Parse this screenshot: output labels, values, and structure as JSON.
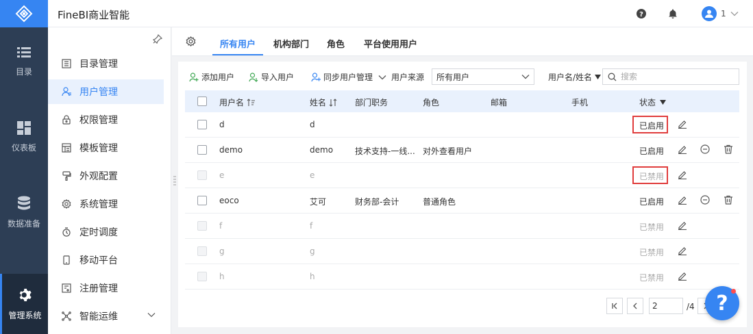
{
  "app": {
    "title": "FineBI商业智能"
  },
  "user": {
    "name": "1"
  },
  "rail": [
    {
      "label": "目录",
      "icon": "list-icon"
    },
    {
      "label": "仪表板",
      "icon": "dashboard-icon"
    },
    {
      "label": "数据准备",
      "icon": "database-icon"
    },
    {
      "label": "管理系统",
      "icon": "gear-icon",
      "active": true
    }
  ],
  "sidebar": {
    "items": [
      {
        "label": "目录管理",
        "icon": "catalog-icon"
      },
      {
        "label": "用户管理",
        "icon": "user-icon",
        "active": true
      },
      {
        "label": "权限管理",
        "icon": "lock-icon"
      },
      {
        "label": "模板管理",
        "icon": "template-icon"
      },
      {
        "label": "外观配置",
        "icon": "brush-icon"
      },
      {
        "label": "系统管理",
        "icon": "settings-icon"
      },
      {
        "label": "定时调度",
        "icon": "timer-icon"
      },
      {
        "label": "移动平台",
        "icon": "mobile-icon"
      },
      {
        "label": "注册管理",
        "icon": "register-icon"
      },
      {
        "label": "智能运维",
        "icon": "ops-icon"
      }
    ]
  },
  "tabs": [
    {
      "label": "所有用户",
      "active": true
    },
    {
      "label": "机构部门"
    },
    {
      "label": "角色"
    },
    {
      "label": "平台使用用户"
    }
  ],
  "toolbar": {
    "add_user": "添加用户",
    "import_user": "导入用户",
    "sync_user": "同步用户管理",
    "source_label": "用户来源",
    "source_value": "所有用户",
    "search_field": "用户名/姓名",
    "search_placeholder": "搜索"
  },
  "table": {
    "headers": {
      "username": "用户名",
      "realname": "姓名",
      "dept": "部门职务",
      "role": "角色",
      "email": "邮箱",
      "phone": "手机",
      "status": "状态"
    },
    "rows": [
      {
        "username": "d",
        "realname": "d",
        "dept": "",
        "role": "",
        "status": "已启用",
        "enabled": true,
        "deletable": false,
        "highlight": true
      },
      {
        "username": "demo",
        "realname": "demo",
        "dept": "技术支持-一线...",
        "role": "对外查看用户",
        "status": "已启用",
        "enabled": true,
        "deletable": true,
        "highlight": false
      },
      {
        "username": "e",
        "realname": "e",
        "dept": "",
        "role": "",
        "status": "已禁用",
        "enabled": false,
        "deletable": false,
        "highlight": true
      },
      {
        "username": "eoco",
        "realname": "艾可",
        "dept": "财务部-会计",
        "role": "普通角色",
        "status": "已启用",
        "enabled": true,
        "deletable": true,
        "highlight": false
      },
      {
        "username": "f",
        "realname": "f",
        "dept": "",
        "role": "",
        "status": "已禁用",
        "enabled": false,
        "deletable": false,
        "highlight": false
      },
      {
        "username": "g",
        "realname": "g",
        "dept": "",
        "role": "",
        "status": "已禁用",
        "enabled": false,
        "deletable": false,
        "highlight": false
      },
      {
        "username": "h",
        "realname": "h",
        "dept": "",
        "role": "",
        "status": "已禁用",
        "enabled": false,
        "deletable": false,
        "highlight": false
      }
    ]
  },
  "pager": {
    "current": "2",
    "total": "/4"
  },
  "help": {
    "label": "?"
  },
  "colors": {
    "accent": "#3685f2",
    "rail": "#2d3e55",
    "highlight": "#e03c3c"
  }
}
